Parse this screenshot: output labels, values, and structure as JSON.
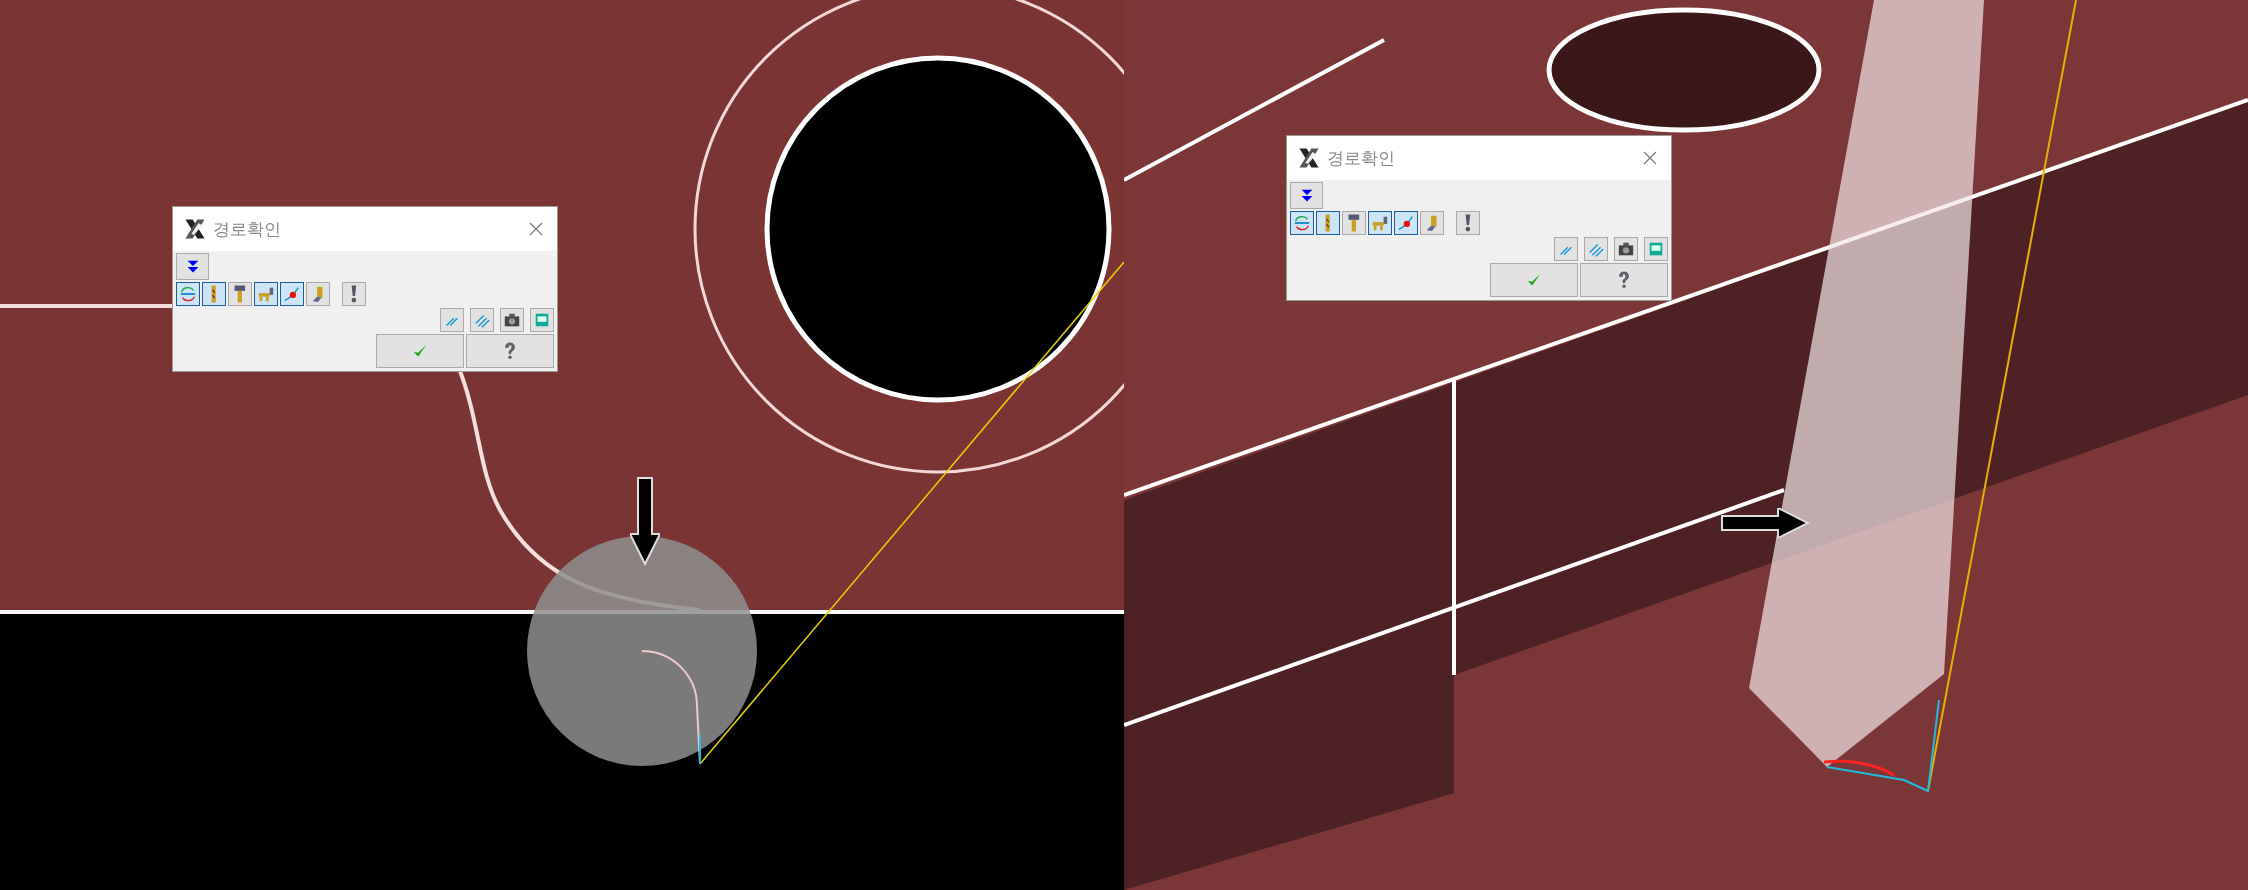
{
  "panels": [
    {
      "kind": "top",
      "dialog": {
        "title": "경로확인",
        "tools": [
          {
            "kind": "sync",
            "selected": true
          },
          {
            "kind": "tool",
            "selected": true
          },
          {
            "kind": "holder",
            "selected": false
          },
          {
            "kind": "assembly",
            "selected": true
          },
          {
            "kind": "point",
            "selected": true
          },
          {
            "kind": "stock",
            "selected": false
          }
        ]
      }
    },
    {
      "kind": "iso",
      "dialog": {
        "title": "경로확인",
        "tools": [
          {
            "kind": "sync",
            "selected": true
          },
          {
            "kind": "tool",
            "selected": true
          },
          {
            "kind": "holder",
            "selected": false
          },
          {
            "kind": "assembly",
            "selected": true
          },
          {
            "kind": "point",
            "selected": true
          },
          {
            "kind": "stock",
            "selected": false
          }
        ]
      }
    }
  ]
}
